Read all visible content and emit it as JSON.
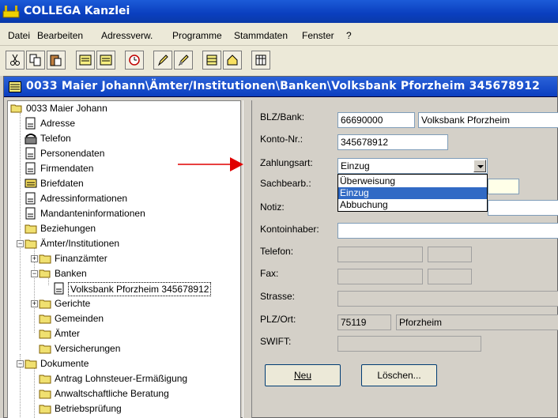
{
  "window": {
    "title": "COLLEGA Kanzlei"
  },
  "menu": [
    "Datei",
    "Bearbeiten",
    "Adressverw.",
    "Programme",
    "Stammdaten",
    "Fenster",
    "?"
  ],
  "toolbar": {
    "buttons": [
      "cut-icon",
      "copy-icon",
      "paste-icon",
      "note-icon",
      "note2-icon",
      "clock-icon",
      "pencil-icon",
      "edit-icon",
      "book-icon",
      "home-icon",
      "table-icon"
    ]
  },
  "document": {
    "title": "0033 Maier Johann\\Ämter/Institutionen\\Banken\\Volksbank Pforzheim 345678912"
  },
  "tree": {
    "root": "0033 Maier Johann",
    "items": [
      "Adresse",
      "Telefon",
      "Personendaten",
      "Firmendaten",
      "Briefdaten",
      "Adressinformationen",
      "Mandanteninformationen",
      "Beziehungen",
      "Ämter/Institutionen",
      "Finanzämter",
      "Banken",
      "Volksbank Pforzheim 345678912",
      "Gerichte",
      "Gemeinden",
      "Ämter",
      "Versicherungen",
      "Dokumente",
      "Antrag Lohnsteuer-Ermäßigung",
      "Anwaltschaftliche Beratung",
      "Betriebsprüfung"
    ]
  },
  "form": {
    "labels": {
      "blz": "BLZ/Bank:",
      "konto": "Konto-Nr.:",
      "zahlungsart": "Zahlungsart:",
      "sachbearb": "Sachbearb.:",
      "notiz": "Notiz:",
      "kontoinhaber": "Kontoinhaber:",
      "telefon": "Telefon:",
      "fax": "Fax:",
      "strasse": "Strasse:",
      "plz": "PLZ/Ort:",
      "swift": "SWIFT:"
    },
    "values": {
      "blz": "66690000",
      "bank": "Volksbank Pforzheim",
      "konto": "345678912",
      "zahlungsart": "Einzug",
      "plz": "75119",
      "ort": "Pforzheim"
    },
    "zahlungsart_options": [
      "Überweisung",
      "Einzug",
      "Abbuchung"
    ],
    "zahlungsart_selected": "Einzug",
    "buttons": {
      "neu": "Neu",
      "loeschen": "Löschen..."
    }
  }
}
